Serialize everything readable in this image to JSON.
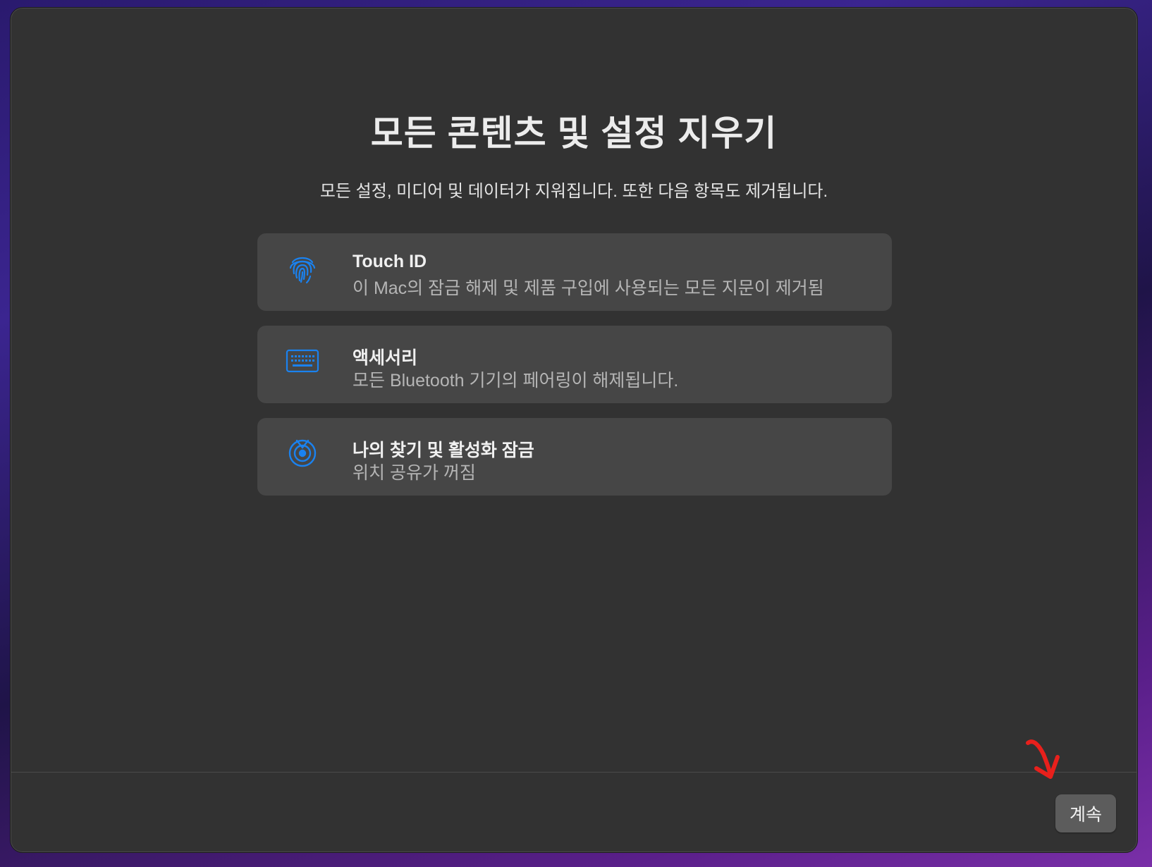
{
  "window": {
    "title": "모든 콘텐츠 및 설정 지우기",
    "subtitle": "모든 설정, 미디어 및 데이터가 지워집니다. 또한 다음 항목도 제거됩니다."
  },
  "items": [
    {
      "icon": "fingerprint-icon",
      "title": "Touch ID",
      "description": "이 Mac의 잠금 해제 및 제품 구입에 사용되는 모든 지문이 제거됨"
    },
    {
      "icon": "keyboard-icon",
      "title": "액세서리",
      "description": "모든 Bluetooth 기기의 페어링이 해제됩니다."
    },
    {
      "icon": "find-my-icon",
      "title": "나의 찾기 및 활성화 잠금",
      "description": "위치 공유가 꺼짐"
    }
  ],
  "footer": {
    "continue_label": "계속"
  },
  "colors": {
    "accent_blue": "#1a82f0",
    "annotation_red": "#e8201c",
    "window_bg": "#323232",
    "card_bg": "#464646"
  }
}
